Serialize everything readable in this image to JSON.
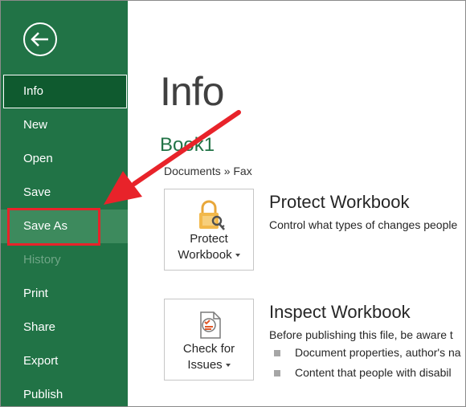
{
  "sidebar": {
    "items": [
      {
        "label": "Info"
      },
      {
        "label": "New"
      },
      {
        "label": "Open"
      },
      {
        "label": "Save"
      },
      {
        "label": "Save As"
      },
      {
        "label": "History"
      },
      {
        "label": "Print"
      },
      {
        "label": "Share"
      },
      {
        "label": "Export"
      },
      {
        "label": "Publish"
      }
    ]
  },
  "main": {
    "title": "Info",
    "workbook_name": "Book1",
    "breadcrumb": "Documents » Fax",
    "protect": {
      "button_line1": "Protect",
      "button_line2": "Workbook",
      "heading": "Protect Workbook",
      "description": "Control what types of changes people"
    },
    "inspect": {
      "button_line1": "Check for",
      "button_line2": "Issues",
      "heading": "Inspect Workbook",
      "description": "Before publishing this file, be aware t",
      "bullets": [
        "Document properties, author's na",
        "Content that people with disabil"
      ]
    }
  },
  "colors": {
    "sidebar_bg": "#217346",
    "annotation_red": "#e8232a"
  },
  "icons": {
    "back": "back-arrow-circle-icon",
    "protect": "padlock-key-icon",
    "inspect": "document-checklist-icon"
  }
}
